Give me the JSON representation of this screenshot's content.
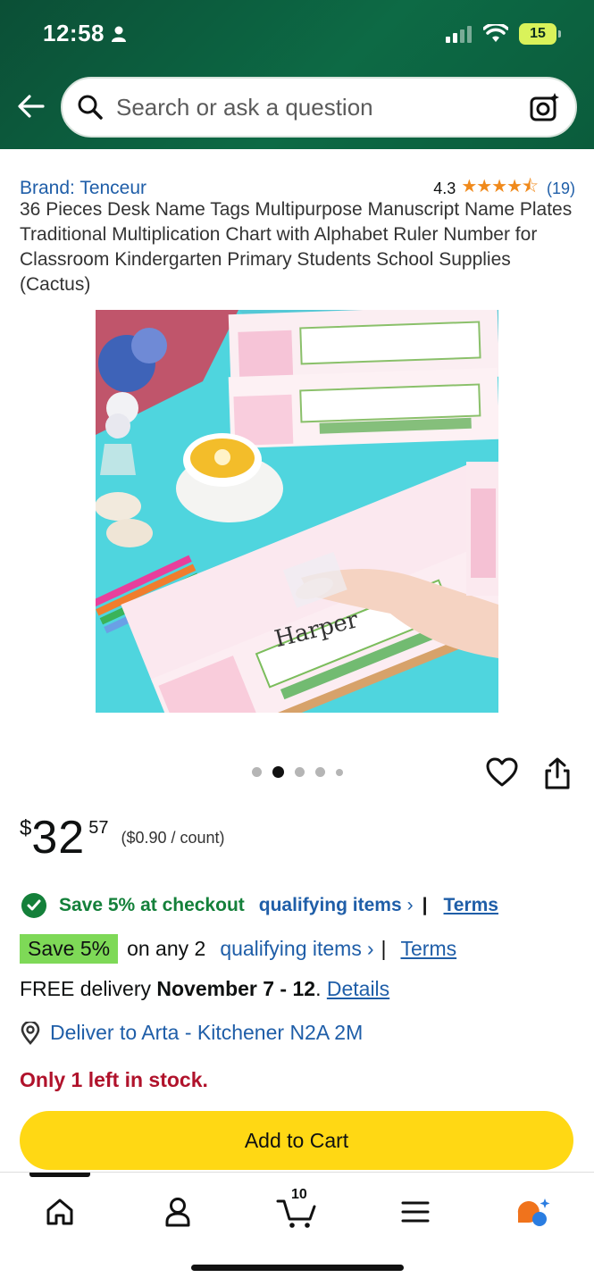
{
  "status_bar": {
    "time": "12:58",
    "battery": "15"
  },
  "search": {
    "placeholder": "Search or ask a question"
  },
  "product": {
    "brand": "Brand: Tenceur",
    "rating": "4.3",
    "stars": "★★★★⯪",
    "review_count": "(19)",
    "title": "36 Pieces Desk Name Tags Multipurpose Manuscript Name Plates Traditional Multiplication Chart with Alphabet Ruler Number for Classroom Kindergarten Primary Students School Supplies (Cactus)",
    "image_name_label": "Harper",
    "carousel": {
      "count": 5,
      "active_index": 1
    }
  },
  "price": {
    "symbol": "$",
    "whole": "32",
    "fraction": "57",
    "unit_price": "($0.90 / count)"
  },
  "promo1": {
    "text": "Save 5% at checkout",
    "link": "qualifying items",
    "chevron": "›",
    "terms": "Terms"
  },
  "promo2": {
    "badge": "Save 5%",
    "text": "on any 2",
    "link": "qualifying items",
    "chevron": "›",
    "terms": "Terms"
  },
  "delivery": {
    "prefix": "FREE delivery",
    "dates": "November 7 - 12",
    "suffix": ".",
    "details": "Details"
  },
  "deliver_to": "Deliver to Arta - Kitchener N2A 2M",
  "stock": "Only 1 left in stock.",
  "add_to_cart": "Add to Cart",
  "bottom_nav": {
    "cart_count": "10"
  },
  "colors": {
    "header_green": "#0d6a45",
    "link_blue": "#1f5ea8",
    "promo_green": "#14803a",
    "cart_yellow": "#ffd814",
    "stock_red": "#b0122b",
    "badge_green": "#7ed957"
  }
}
